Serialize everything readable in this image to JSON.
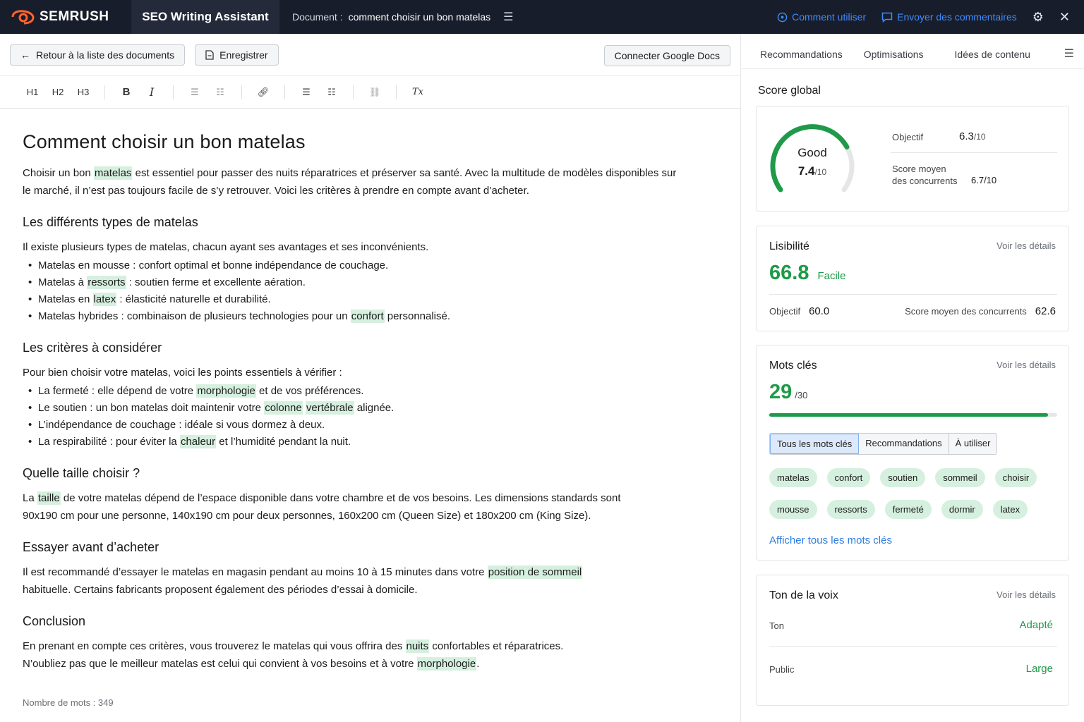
{
  "topbar": {
    "brand": "SEMRUSH",
    "app_name": "SEO Writing Assistant",
    "doc_label": "Document :",
    "doc_name": "comment choisir un bon matelas",
    "help_link": "Comment utiliser",
    "feedback_link": "Envoyer des commentaires"
  },
  "actions": {
    "back": "Retour à la liste des documents",
    "save": "Enregistrer",
    "connect_gdocs": "Connecter Google Docs"
  },
  "toolbar": {
    "h1": "H1",
    "h2": "H2",
    "h3": "H3",
    "bold": "B",
    "italic": "I",
    "clear": "Tx"
  },
  "document": {
    "title": "Comment choisir un bon matelas",
    "intro": [
      {
        "t": "Choisir un bon "
      },
      {
        "k": "matelas"
      },
      {
        "t": " est essentiel pour passer des nuits réparatrices et préserver sa santé. Avec la multitude de modèles disponibles sur le marché, il n’est pas toujours facile de s’y retrouver. Voici les critères à prendre en compte avant d’acheter."
      }
    ],
    "s1_title": "Les différents types de matelas",
    "s1_text": "Il existe plusieurs types de matelas, chacun ayant ses avantages et ses inconvénients.",
    "s1_items": [
      [
        {
          "t": "Matelas en mousse : confort optimal et bonne indépendance de couchage."
        }
      ],
      [
        {
          "t": "Matelas à "
        },
        {
          "k": "ressorts"
        },
        {
          "t": " : soutien ferme et excellente aération."
        }
      ],
      [
        {
          "t": "Matelas en "
        },
        {
          "k": "latex"
        },
        {
          "t": " : élasticité naturelle et durabilité."
        }
      ],
      [
        {
          "t": "Matelas hybrides : combinaison de plusieurs technologies pour un "
        },
        {
          "k": "confort"
        },
        {
          "t": " personnalisé."
        }
      ]
    ],
    "s2_title": "Les critères à considérer",
    "s2_text": "Pour bien choisir votre matelas, voici les points essentiels à vérifier :",
    "s2_items": [
      [
        {
          "t": "La fermeté : elle dépend de votre "
        },
        {
          "k": "morphologie"
        },
        {
          "t": " et de vos préférences."
        }
      ],
      [
        {
          "t": "Le soutien : un bon matelas doit maintenir votre "
        },
        {
          "k": "colonne"
        },
        {
          "t": " "
        },
        {
          "k": "vertébrale"
        },
        {
          "t": " alignée."
        }
      ],
      [
        {
          "t": "L’indépendance de couchage : idéale si vous dormez à deux."
        }
      ],
      [
        {
          "t": "La respirabilité : pour éviter la "
        },
        {
          "k": "chaleur"
        },
        {
          "t": " et l’humidité pendant la nuit."
        }
      ]
    ],
    "s3_title": "Quelle taille choisir ?",
    "s3_text": [
      {
        "t": "La "
      },
      {
        "k": "taille"
      },
      {
        "t": " de votre matelas dépend de l’espace disponible dans votre chambre et de vos besoins. Les dimensions standards sont 90x190 cm pour une personne, 140x190 cm pour deux personnes, 160x200 cm (Queen Size) et 180x200 cm (King Size)."
      }
    ],
    "s4_title": "Essayer avant d’acheter",
    "s4_text": [
      {
        "t": "Il est recommandé d’essayer le matelas en magasin pendant au moins 10 à 15 minutes dans votre "
      },
      {
        "k": "position de sommeil"
      },
      {
        "t": " habituelle. Certains fabricants proposent également des périodes d’essai à domicile."
      }
    ],
    "s5_title": "Conclusion",
    "s5_text": [
      {
        "t": "En prenant en compte ces critères, vous trouverez le matelas qui vous offrira des "
      },
      {
        "k": "nuits"
      },
      {
        "t": " confortables et réparatrices. N’oubliez pas que le meilleur matelas est celui qui convient à vos besoins et à votre "
      },
      {
        "k": "morphologie"
      },
      {
        "t": "."
      }
    ],
    "word_count": "Nombre de mots : 349"
  },
  "panel": {
    "tabs": [
      "Recommandations",
      "Optimisations",
      "Idées de contenu"
    ],
    "active_tab": 0,
    "score": {
      "section_title": "Score global",
      "gauge_label": "Good",
      "value": "7.4",
      "out_of": "/10",
      "fraction": 0.74,
      "objective_label": "Objectif",
      "objective_value": "6.3",
      "objective_out_of": "/10",
      "competitors_label_1": "Score moyen",
      "competitors_label_2": "des concurrents",
      "competitors_value": "6.7/10"
    },
    "readability": {
      "title": "Lisibilité",
      "details": "Voir les détails",
      "value": "66.8",
      "level": "Facile",
      "objective_label": "Objectif",
      "objective_value": "60.0",
      "competitors_label": "Score moyen des concurrents",
      "competitors_value": "62.6"
    },
    "keywords": {
      "title": "Mots clés",
      "details": "Voir les détails",
      "value": "29",
      "out_of": "/30",
      "fraction": 0.967,
      "filters": [
        "Tous les mots clés",
        "Recommandations",
        "À utiliser"
      ],
      "active_filter": 0,
      "chips": [
        "matelas",
        "confort",
        "soutien",
        "sommeil",
        "choisir",
        "mousse",
        "ressorts",
        "fermeté",
        "dormir",
        "latex"
      ],
      "show_all": "Afficher tous les mots clés"
    },
    "tone": {
      "title": "Ton de la voix",
      "details": "Voir les détails",
      "ton_label": "Ton",
      "ton_value": "Adapté",
      "public_label": "Public",
      "public_value": "Large"
    }
  },
  "colors": {
    "topbar": "#181d2b",
    "accent_blue": "#2f7de1",
    "green": "#1e9a48",
    "keyword_highlight": "#d6f0df"
  },
  "icons": [
    "semrush-logo-icon",
    "menu-icon",
    "help-circle-icon",
    "comment-icon",
    "gear-icon",
    "close-icon",
    "arrow-left-icon",
    "document-icon",
    "link-icon",
    "list-icon",
    "unlink-icon"
  ]
}
